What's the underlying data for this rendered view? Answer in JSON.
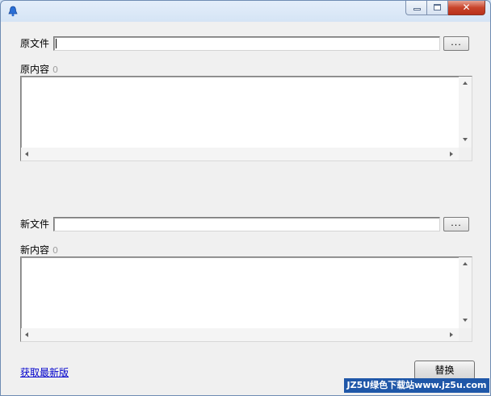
{
  "window": {
    "icon": "bell-icon",
    "controls": {
      "minimize": "minimize-icon",
      "maximize": "maximize-icon",
      "close": "✕"
    }
  },
  "source": {
    "file_label": "原文件",
    "file_value": "",
    "browse_label": "...",
    "content_label": "原内容",
    "content_count": "0"
  },
  "target": {
    "file_label": "新文件",
    "file_value": "",
    "browse_label": "...",
    "content_label": "新内容",
    "content_count": "0"
  },
  "footer": {
    "update_link": "获取最新版",
    "replace_button": "替换",
    "watermark": "JZ5U绿色下载站www.jz5u.com"
  },
  "colors": {
    "link": "#0000cc",
    "watermark_bg": "#1f57a8"
  }
}
